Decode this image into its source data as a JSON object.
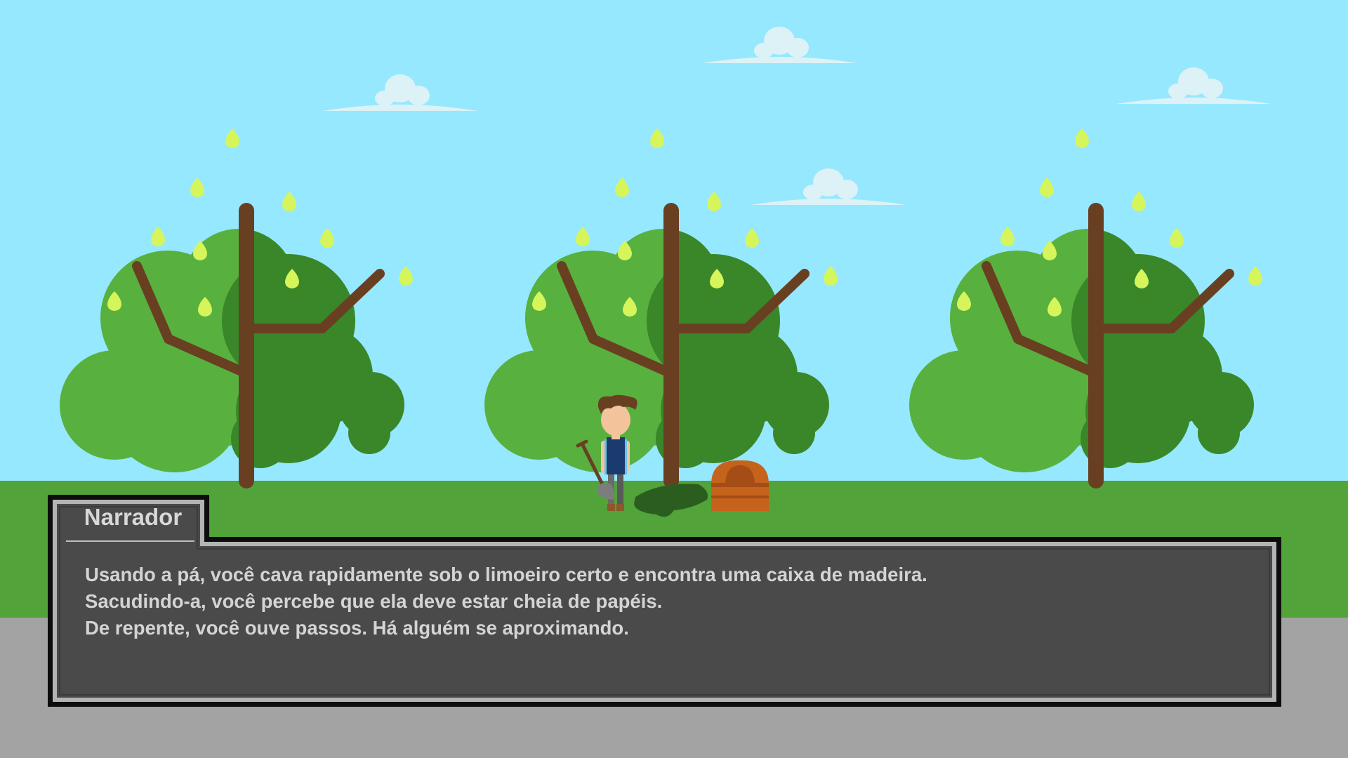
{
  "colors": {
    "sky": "#96e8fe",
    "cloud": "#dcf2f6",
    "grass": "#52a33a",
    "road": "#a3a3a3",
    "foliage_light": "#58b13e",
    "foliage_dark": "#398728",
    "trunk": "#693f22",
    "lemon": "#d6f55b",
    "dialog_bg": "#4a4a4a",
    "dialog_text": "#d6d6d6"
  },
  "scene": {
    "icons": {
      "trees": "lemon-tree-icon",
      "character": "digger-character-icon",
      "shovel": "shovel-icon",
      "hole": "dug-hole-icon",
      "chest": "wooden-box-icon",
      "clouds": "cloud-icon"
    }
  },
  "dialog": {
    "speaker": "Narrador",
    "lines": [
      "Usando a pá, você cava rapidamente sob o limoeiro certo e encontra uma caixa de madeira.",
      "Sacudindo-a, você percebe que ela deve estar cheia de papéis.",
      "De repente, você ouve passos. Há alguém se aproximando."
    ]
  }
}
